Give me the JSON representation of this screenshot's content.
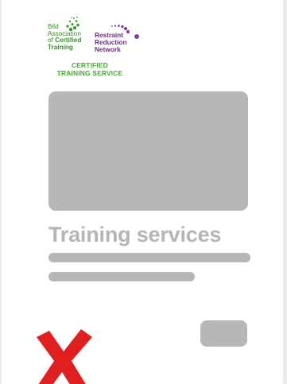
{
  "logos": {
    "bild": {
      "line1": "Bild",
      "line2": "Association",
      "line3_prefix": "of ",
      "line3_bold": "Certified",
      "line4": "Training",
      "color": "#3a8f2c"
    },
    "rrn": {
      "line1": "Restraint",
      "line2": "Reduction",
      "line3": "Network",
      "color": "#6b2d86"
    },
    "certified_line1": "CERTIFIED",
    "certified_line2": "TRAINING SERVICE",
    "certified_color": "#3fae2a"
  },
  "card": {
    "title": "Training services",
    "placeholder_color": "#b7b7b7"
  },
  "cross_icon": {
    "icon": "red-x-icon",
    "color": "#e0201f"
  }
}
